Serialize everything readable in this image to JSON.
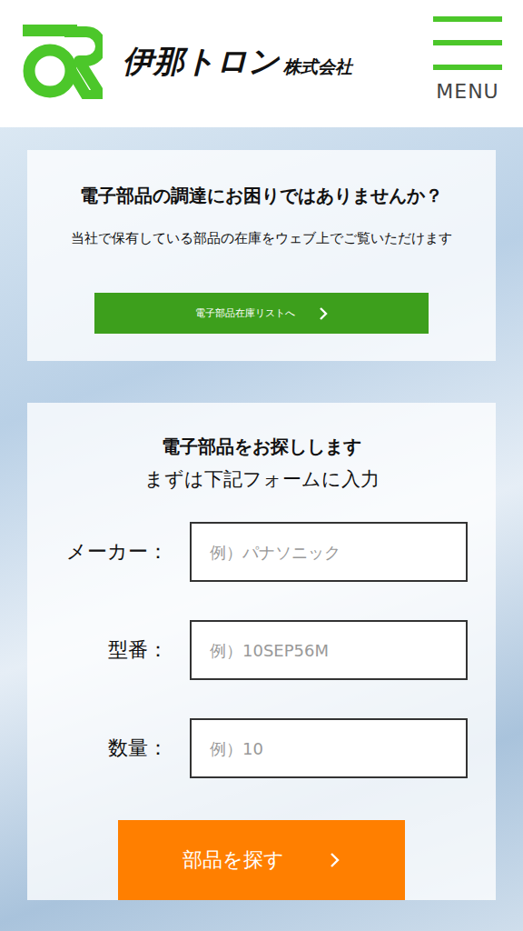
{
  "header": {
    "logo_text": "伊那トロン",
    "logo_suffix": "株式会社",
    "menu_label": "MENU"
  },
  "stock_card": {
    "title": "電子部品の調達にお困りではありませんか？",
    "description": "当社で保有している部品の在庫をウェブ上でご覧いただけます",
    "button": "電子部品在庫リストへ"
  },
  "search_card": {
    "title": "電子部品をお探しします",
    "subtitle": "まずは下記フォームに入力",
    "fields": [
      {
        "label": "メーカー：",
        "placeholder": "例）パナソニック"
      },
      {
        "label": "型番：",
        "placeholder": "例）10SEP56M"
      },
      {
        "label": "数量：",
        "placeholder": "例）10"
      }
    ],
    "submit": "部品を探す"
  }
}
